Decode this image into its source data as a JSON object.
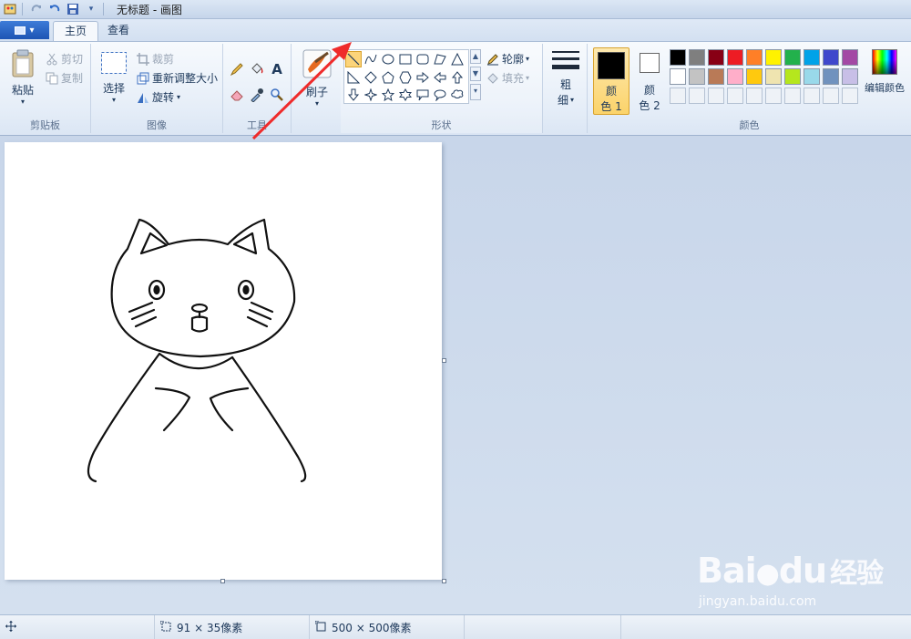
{
  "window": {
    "title": "无标题 - 画图"
  },
  "tabs": [
    {
      "label": "主页",
      "active": true
    },
    {
      "label": "查看",
      "active": false
    }
  ],
  "clipboard": {
    "paste_label": "粘贴",
    "cut_label": "剪切",
    "copy_label": "复制",
    "group_label": "剪贴板"
  },
  "image": {
    "select_label": "选择",
    "crop_label": "裁剪",
    "resize_label": "重新调整大小",
    "rotate_label": "旋转",
    "group_label": "图像"
  },
  "tools": {
    "text_tool_glyph": "A",
    "group_label": "工具"
  },
  "brushes": {
    "label": "刷子"
  },
  "shapes": {
    "outline_label": "轮廓",
    "fill_label": "填充",
    "group_label": "形状",
    "selected": "line"
  },
  "size": {
    "label_line1": "粗",
    "label_line2": "细"
  },
  "colors": {
    "color1_line1": "颜",
    "color1_line2": "色 1",
    "color2_line1": "颜",
    "color2_line2": "色 2",
    "edit_label": "编辑颜色",
    "group_label": "颜色",
    "color1_value": "#000000",
    "color2_value": "#ffffff",
    "palette_row1": [
      "#000000",
      "#7f7f7f",
      "#880015",
      "#ed1c24",
      "#ff7f27",
      "#fff200",
      "#22b14c",
      "#00a2e8",
      "#3f48cc",
      "#a349a4"
    ],
    "palette_row2": [
      "#ffffff",
      "#c3c3c3",
      "#b97a57",
      "#ffaec9",
      "#ffc90e",
      "#efe4b0",
      "#b5e61d",
      "#99d9ea",
      "#7092be",
      "#c8bfe7"
    ]
  },
  "status": {
    "selection_size": "91 × 35像素",
    "image_size": "500 × 500像素"
  },
  "watermark": {
    "brand": "Bai",
    "brand_tail": "经验",
    "url": "jingyan.baidu.com"
  }
}
